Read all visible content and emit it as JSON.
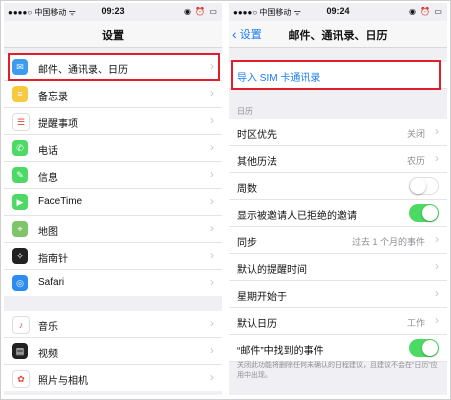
{
  "left": {
    "status": {
      "carrier": "●●●●○ 中国移动 ᯤ",
      "time": "09:23",
      "right_icons": "◉ ⏰ ▭"
    },
    "nav_title": "设置",
    "group1": [
      {
        "label": "邮件、通讯录、日历",
        "icon": "mail-icon",
        "color": "#3d9cf0",
        "glyph": "✉"
      },
      {
        "label": "备忘录",
        "icon": "notes-icon",
        "color": "#f7c940",
        "glyph": "≡"
      },
      {
        "label": "提醒事项",
        "icon": "reminders-icon",
        "color": "#ffffff",
        "glyph": "☰"
      },
      {
        "label": "电话",
        "icon": "phone-icon",
        "color": "#4cd964",
        "glyph": "✆"
      },
      {
        "label": "信息",
        "icon": "messages-icon",
        "color": "#4cd964",
        "glyph": "✎"
      },
      {
        "label": "FaceTime",
        "icon": "facetime-icon",
        "color": "#4cd964",
        "glyph": "▶"
      },
      {
        "label": "地图",
        "icon": "maps-icon",
        "color": "#7fc36b",
        "glyph": "⌖"
      },
      {
        "label": "指南针",
        "icon": "compass-icon",
        "color": "#222222",
        "glyph": "✧"
      },
      {
        "label": "Safari",
        "icon": "safari-icon",
        "color": "#2d8cf0",
        "glyph": "◎"
      }
    ],
    "group2": [
      {
        "label": "音乐",
        "icon": "music-icon",
        "color": "#ffffff",
        "glyph": "♪"
      },
      {
        "label": "视频",
        "icon": "video-icon",
        "color": "#222222",
        "glyph": "▤"
      },
      {
        "label": "照片与相机",
        "icon": "photos-icon",
        "color": "#ffffff",
        "glyph": "✿"
      }
    ]
  },
  "right": {
    "status": {
      "carrier": "●●●●○ 中国移动 ᯤ",
      "time": "09:24",
      "right_icons": "◉ ⏰ ▭"
    },
    "back_label": "设置",
    "nav_title": "邮件、通讯录、日历",
    "import_sim": "导入 SIM 卡通讯录",
    "section_calendar": "日历",
    "rows": [
      {
        "label": "时区优先",
        "value": "关闭",
        "kind": "chevron"
      },
      {
        "label": "其他历法",
        "value": "农历",
        "kind": "chevron"
      },
      {
        "label": "周数",
        "value": "",
        "kind": "toggle-off"
      },
      {
        "label": "显示被邀请人已拒绝的邀请",
        "value": "",
        "kind": "toggle-on"
      },
      {
        "label": "同步",
        "value": "过去 1 个月的事件",
        "kind": "chevron"
      },
      {
        "label": "默认的提醒时间",
        "value": "",
        "kind": "chevron"
      },
      {
        "label": "星期开始于",
        "value": "",
        "kind": "chevron"
      },
      {
        "label": "默认日历",
        "value": "工作",
        "kind": "chevron"
      },
      {
        "label": "“邮件”中找到的事件",
        "value": "",
        "kind": "toggle-on"
      }
    ],
    "footnote": "关闭此功能将删除任何未确认的日程建议，且建议不会在“日历”应用中出现。"
  },
  "colors": {
    "highlight": "#e01f2b",
    "ios_blue": "#1a7cf4",
    "toggle_green": "#4cd964"
  }
}
